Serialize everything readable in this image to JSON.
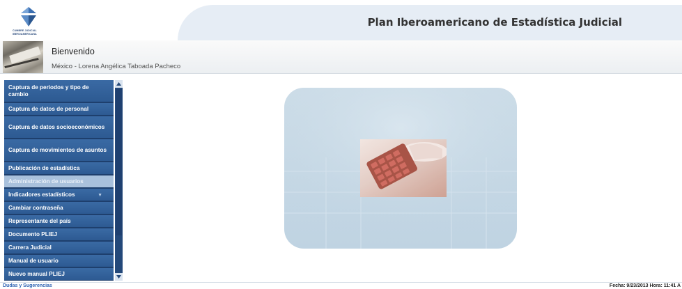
{
  "header": {
    "logo_text": [
      "CUMBRE JUDICIAL",
      "IBEROAMERICANA"
    ],
    "title": "Plan Iberoamericano de Estadística Judicial"
  },
  "welcome": {
    "greeting": "Bienvenido",
    "country": "México",
    "separator": " - ",
    "user": "Lorena Angélica Taboada Pacheco"
  },
  "sidebar": {
    "items": [
      {
        "label": "Captura de periodos y tipo de cambio"
      },
      {
        "label": "Captura de datos de personal"
      },
      {
        "label": "Captura de datos socioeconómicos"
      },
      {
        "label": "Captura de movimientos de asuntos"
      },
      {
        "label": "Publicación de estadística"
      },
      {
        "label": "Administración de usuarios"
      },
      {
        "label": "Indicadores estadísticos"
      },
      {
        "label": "Cambiar contraseña"
      },
      {
        "label": "Representante del país"
      },
      {
        "label": "Documento PLIEJ"
      },
      {
        "label": "Carrera Judicial"
      },
      {
        "label": "Manual de usuario"
      },
      {
        "label": "Nuevo manual PLIEJ"
      }
    ],
    "active_index": 5,
    "expandable_index": 6
  },
  "footer": {
    "link": "Dudas y Sugerencias",
    "datetime": "Fecha: 9/23/2013 Hora: 11:41 A"
  },
  "colors": {
    "menu_bg": "#2c5489",
    "menu_active": "#a9c1dc",
    "footer_link": "#2e63b2"
  }
}
